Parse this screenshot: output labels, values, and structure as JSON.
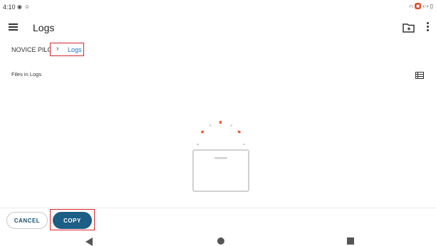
{
  "status_bar": {
    "time": "4:10"
  },
  "app_bar": {
    "title": "Logs"
  },
  "breadcrumb": {
    "root": "NOVICE PILOT",
    "current": "Logs"
  },
  "files_section": {
    "title": "Files in Logs"
  },
  "actions": {
    "cancel_label": "CANCEL",
    "copy_label": "COPY"
  },
  "colors": {
    "accent": "#1c5e85",
    "link": "#1a73c9",
    "highlight": "#d9262f"
  }
}
